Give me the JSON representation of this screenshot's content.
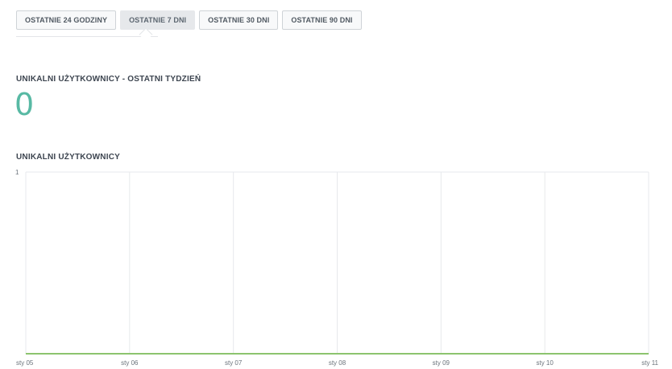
{
  "range_tabs": [
    {
      "label": "OSTATNIE 24 GODZINY",
      "active": false
    },
    {
      "label": "OSTATNIE 7 DNI",
      "active": true
    },
    {
      "label": "OSTATNIE 30 DNI",
      "active": false
    },
    {
      "label": "OSTATNIE 90 DNI",
      "active": false
    }
  ],
  "summary": {
    "title": "UNIKALNI UŻYTKOWNICY - OSTATNI TYDZIEŃ",
    "value": "0"
  },
  "chart_section": {
    "title": "UNIKALNI UŻYTKOWNICY"
  },
  "colors": {
    "accent_number": "#58b9a4",
    "series_line": "#8cc46e",
    "grid": "#e7e9ec"
  },
  "chart_data": {
    "type": "line",
    "x": [
      "sty 05",
      "sty 06",
      "sty 07",
      "sty 08",
      "sty 09",
      "sty 10",
      "sty 11"
    ],
    "series": [
      {
        "values": [
          0,
          0,
          0,
          0,
          0,
          0,
          0
        ]
      }
    ],
    "ylim": [
      0,
      1
    ],
    "y_ticks": [
      "1"
    ],
    "grid": true
  }
}
